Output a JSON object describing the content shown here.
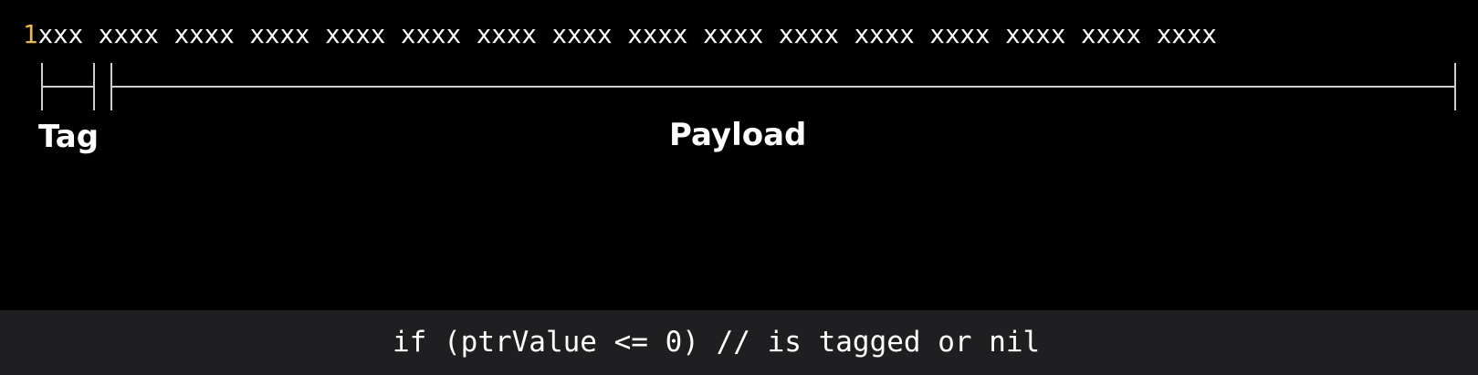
{
  "diagram": {
    "bits": {
      "lead_bit": "1",
      "rest": "xxx xxxx xxxx xxxx xxxx xxxx xxxx xxxx xxxx xxxx xxxx xxxx xxxx xxxx xxxx xxxx"
    },
    "segments": {
      "tag_label": "Tag",
      "payload_label": "Payload"
    },
    "colors": {
      "background": "#000000",
      "lead_bit": "#e9b949",
      "text": "#ffffff",
      "bracket": "#cfcfcf",
      "code_bar": "#1f1f22"
    }
  },
  "code": {
    "line": "if (ptrValue <= 0) // is tagged or nil"
  }
}
